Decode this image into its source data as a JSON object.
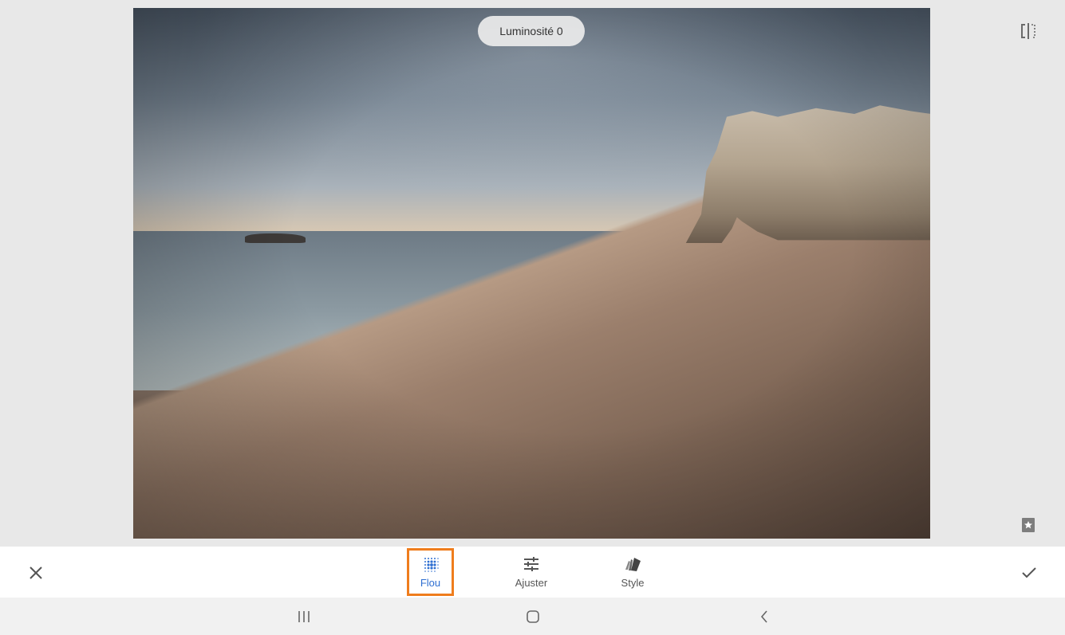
{
  "toast": {
    "text": "Luminosité 0"
  },
  "tools": [
    {
      "label": "Flou",
      "icon": "blur-grid-icon",
      "active": true
    },
    {
      "label": "Ajuster",
      "icon": "sliders-icon",
      "active": false
    },
    {
      "label": "Style",
      "icon": "style-cards-icon",
      "active": false
    }
  ],
  "actions": {
    "close_icon": "close-icon",
    "confirm_icon": "check-icon"
  },
  "side": {
    "compare_icon": "compare-icon",
    "bookmark_icon": "bookmark-icon"
  },
  "navbar": {
    "recents_icon": "recents-icon",
    "home_icon": "home-icon",
    "back_icon": "back-icon"
  },
  "colors": {
    "active_label": "#2f6fd1",
    "highlight_border": "#ef7d1d",
    "toolbar_bg": "#ffffff",
    "stage_bg": "#e8e8e8"
  }
}
